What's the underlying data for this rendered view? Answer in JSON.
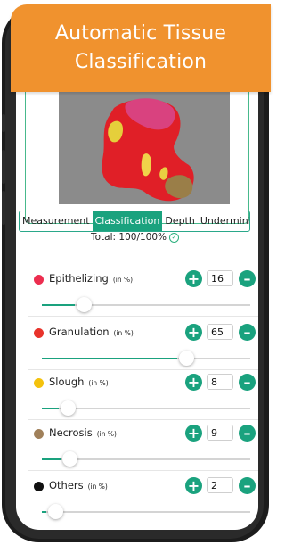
{
  "banner": {
    "line1": "Automatic Tissue",
    "line2": "Classification"
  },
  "tabs": [
    {
      "label": "Measurement",
      "active": false
    },
    {
      "label": "Classification",
      "active": true
    },
    {
      "label": "Depth",
      "active": false
    },
    {
      "label": "Underminin",
      "active": false
    }
  ],
  "total": {
    "text": "Total: 100/100%"
  },
  "tissues": [
    {
      "name": "Epithelizing",
      "unit": "(in %)",
      "value": "16",
      "fraction": 0.16,
      "color": "#ec2d4f"
    },
    {
      "name": "Granulation",
      "unit": "(in %)",
      "value": "65",
      "fraction": 0.65,
      "color": "#e8332b"
    },
    {
      "name": "Slough",
      "unit": "(in %)",
      "value": "8",
      "fraction": 0.08,
      "color": "#f4c20d"
    },
    {
      "name": "Necrosis",
      "unit": "(in %)",
      "value": "9",
      "fraction": 0.09,
      "color": "#a0805a"
    },
    {
      "name": "Others",
      "unit": "(in %)",
      "value": "2",
      "fraction": 0.02,
      "color": "#111111"
    }
  ],
  "colors": {
    "accent": "#1aa27e",
    "banner": "#f0922e"
  }
}
